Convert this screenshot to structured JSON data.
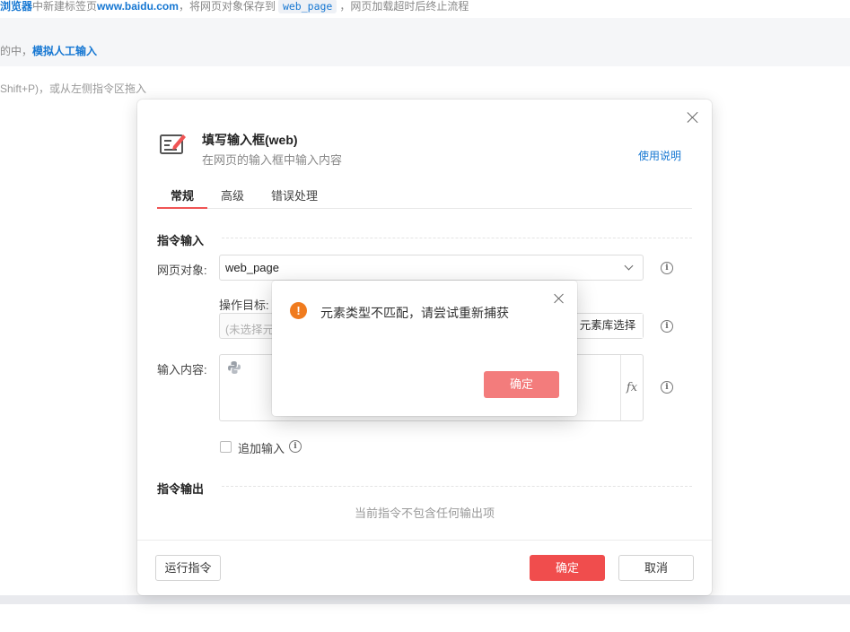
{
  "background": {
    "line1_prefix": "浏览器",
    "line1_mid": "中新建标签页",
    "line1_url": "www.baidu.com",
    "line1_save": "，将网页对象保存到",
    "line1_var": "web_page",
    "line1_tail": "，网页加载超时后终止流程",
    "line2_prefix": "的中，",
    "line2_link": "模拟人工输入",
    "line3": "Shift+P)，或从左侧指令区拖入"
  },
  "dialog": {
    "title": "填写输入框(web)",
    "subtitle": "在网页的输入框中输入内容",
    "help_link": "使用说明",
    "tabs": [
      "常规",
      "高级",
      "错误处理"
    ],
    "section_input": "指令输入",
    "web_object_label": "网页对象:",
    "web_object_value": "web_page",
    "target_label": "操作目标:",
    "target_placeholder": "(未选择元素)",
    "element_lib_button": "元素库选择",
    "content_label": "输入内容:",
    "fx_label": "fx",
    "append_label": "追加输入",
    "section_output": "指令输出",
    "output_empty": "当前指令不包含任何输出项",
    "run_button": "运行指令",
    "ok_button": "确定",
    "cancel_button": "取消"
  },
  "alert": {
    "message": "元素类型不匹配，请尝试重新捕获",
    "ok_button": "确定",
    "icon_glyph": "!"
  },
  "colors": {
    "accent_red": "#f04d4d",
    "link_blue": "#1677d2",
    "warning_orange": "#f07b1e"
  }
}
